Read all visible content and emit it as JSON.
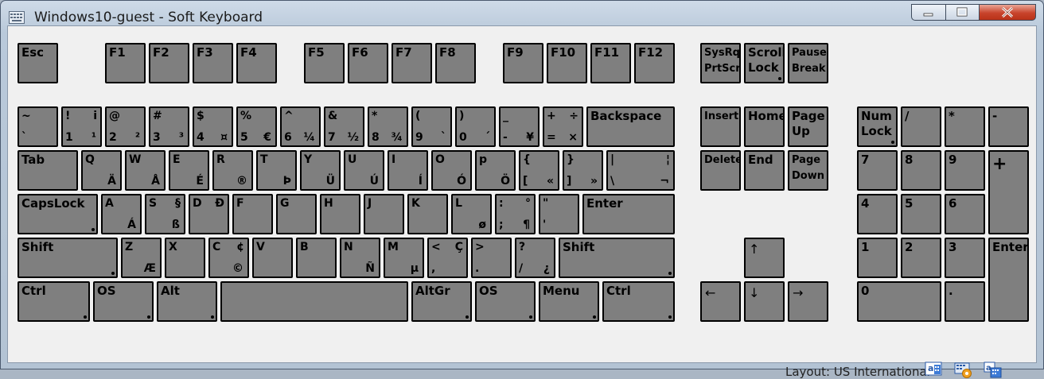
{
  "window": {
    "title": "Windows10-guest - Soft Keyboard"
  },
  "status": {
    "layout_label": "Layout: US International"
  },
  "status_icons": [
    {
      "name": "keyboard-language-icon"
    },
    {
      "name": "keyboard-settings-icon"
    },
    {
      "name": "keyboard-switch-icon"
    }
  ],
  "keys": [
    {
      "id": "esc",
      "label": "Esc"
    },
    {
      "id": "f1",
      "label": "F1"
    },
    {
      "id": "f2",
      "label": "F2"
    },
    {
      "id": "f3",
      "label": "F3"
    },
    {
      "id": "f4",
      "label": "F4"
    },
    {
      "id": "f5",
      "label": "F5"
    },
    {
      "id": "f6",
      "label": "F6"
    },
    {
      "id": "f7",
      "label": "F7"
    },
    {
      "id": "f8",
      "label": "F8"
    },
    {
      "id": "f9",
      "label": "F9"
    },
    {
      "id": "f10",
      "label": "F10"
    },
    {
      "id": "f11",
      "label": "F11"
    },
    {
      "id": "f12",
      "label": "F12"
    },
    {
      "id": "sysrq",
      "label2": "SysRq\nPrtScr"
    },
    {
      "id": "scrolllock",
      "label": "Scroll\nLock",
      "toggle": true
    },
    {
      "id": "pause",
      "label2": "Pause\nBreak"
    },
    {
      "id": "grave",
      "tl": "~",
      "bl": "`"
    },
    {
      "id": "1",
      "tl": "!",
      "tr": "i",
      "bl": "1",
      "br": "¹"
    },
    {
      "id": "2",
      "tl": "@",
      "bl": "2",
      "br": "²"
    },
    {
      "id": "3",
      "tl": "#",
      "bl": "3",
      "br": "³"
    },
    {
      "id": "4",
      "tl": "$",
      "bl": "4",
      "br": "¤"
    },
    {
      "id": "5",
      "tl": "%",
      "bl": "5",
      "br": "€"
    },
    {
      "id": "6",
      "tl": "^",
      "bl": "6",
      "br": "¼"
    },
    {
      "id": "7",
      "tl": "&",
      "bl": "7",
      "br": "½"
    },
    {
      "id": "8",
      "tl": "*",
      "bl": "8",
      "br": "¾"
    },
    {
      "id": "9",
      "tl": "(",
      "bl": "9",
      "br": "`"
    },
    {
      "id": "0",
      "tl": ")",
      "bl": "0",
      "br": "´"
    },
    {
      "id": "minus",
      "tl": "_",
      "bl": "-",
      "br": "¥"
    },
    {
      "id": "equals",
      "tl": "+",
      "tr": "÷",
      "bl": "=",
      "br": "×"
    },
    {
      "id": "backspace",
      "label": "Backspace"
    },
    {
      "id": "insert",
      "label2": "Insert"
    },
    {
      "id": "home",
      "label": "Home"
    },
    {
      "id": "pageup",
      "label": "Page\nUp"
    },
    {
      "id": "numlock",
      "label": "Num\nLock",
      "toggle": true
    },
    {
      "id": "numdiv",
      "label": "/"
    },
    {
      "id": "nummul",
      "label": "*"
    },
    {
      "id": "numsub",
      "label": "-"
    },
    {
      "id": "tab",
      "label": "Tab"
    },
    {
      "id": "q",
      "tl": "Q",
      "br": "Ä"
    },
    {
      "id": "w",
      "tl": "W",
      "br": "Å"
    },
    {
      "id": "e",
      "tl": "E",
      "br": "É"
    },
    {
      "id": "r",
      "tl": "R",
      "br": "®"
    },
    {
      "id": "t",
      "tl": "T",
      "br": "Þ"
    },
    {
      "id": "y",
      "tl": "Y",
      "br": "Ü"
    },
    {
      "id": "u",
      "tl": "U",
      "br": "Ú"
    },
    {
      "id": "i",
      "tl": "I",
      "br": "Í"
    },
    {
      "id": "o",
      "tl": "O",
      "br": "Ó"
    },
    {
      "id": "p",
      "tl": "p",
      "br": "Ö"
    },
    {
      "id": "lbracket",
      "tl": "{",
      "bl": "[",
      "br": "«"
    },
    {
      "id": "rbracket",
      "tl": "}",
      "bl": "]",
      "br": "»"
    },
    {
      "id": "backslash",
      "tl": "|",
      "tr": "¦",
      "bl": "\\",
      "br": "¬"
    },
    {
      "id": "delete",
      "label2": "Delete"
    },
    {
      "id": "end",
      "label": "End"
    },
    {
      "id": "pagedown",
      "label2": "Page\nDown"
    },
    {
      "id": "num7",
      "label": "7"
    },
    {
      "id": "num8",
      "label": "8"
    },
    {
      "id": "num9",
      "label": "9"
    },
    {
      "id": "numadd",
      "label": "+"
    },
    {
      "id": "capslock",
      "label": "CapsLock",
      "toggle": true
    },
    {
      "id": "a",
      "tl": "A",
      "br": "Á"
    },
    {
      "id": "s",
      "tl": "S",
      "tr": "§",
      "br": "ß"
    },
    {
      "id": "d",
      "tl": "D",
      "tr": "Ð"
    },
    {
      "id": "f",
      "tl": "F"
    },
    {
      "id": "g",
      "tl": "G"
    },
    {
      "id": "h",
      "tl": "H"
    },
    {
      "id": "j",
      "tl": "J"
    },
    {
      "id": "k",
      "tl": "K"
    },
    {
      "id": "l",
      "tl": "L",
      "br": "ø"
    },
    {
      "id": "semicolon",
      "tl": ":",
      "tr": "°",
      "bl": ";",
      "br": "¶"
    },
    {
      "id": "quote",
      "tl": "\"",
      "bl": "'"
    },
    {
      "id": "enter",
      "label": "Enter"
    },
    {
      "id": "num4",
      "label": "4"
    },
    {
      "id": "num5",
      "label": "5"
    },
    {
      "id": "num6",
      "label": "6"
    },
    {
      "id": "lshift",
      "label": "Shift",
      "toggle": true
    },
    {
      "id": "z",
      "tl": "Z",
      "br": "Æ"
    },
    {
      "id": "x",
      "tl": "X"
    },
    {
      "id": "c",
      "tl": "C",
      "tr": "¢",
      "br": "©"
    },
    {
      "id": "v",
      "tl": "V"
    },
    {
      "id": "b",
      "tl": "B"
    },
    {
      "id": "n",
      "tl": "N",
      "br": "Ñ"
    },
    {
      "id": "m",
      "tl": "M",
      "br": "µ"
    },
    {
      "id": "comma",
      "tl": "<",
      "tr": "Ç",
      "bl": ","
    },
    {
      "id": "period",
      "tl": ">",
      "bl": "."
    },
    {
      "id": "slash",
      "tl": "?",
      "bl": "/",
      "br": "¿"
    },
    {
      "id": "rshift",
      "label": "Shift",
      "toggle": true
    },
    {
      "id": "up",
      "arrow": "↑"
    },
    {
      "id": "num1",
      "label": "1"
    },
    {
      "id": "num2",
      "label": "2"
    },
    {
      "id": "num3",
      "label": "3"
    },
    {
      "id": "numenter",
      "label": "Enter"
    },
    {
      "id": "lctrl",
      "label": "Ctrl",
      "toggle": true
    },
    {
      "id": "los",
      "label": "OS",
      "toggle": true
    },
    {
      "id": "lalt",
      "label": "Alt",
      "toggle": true
    },
    {
      "id": "space",
      "label": ""
    },
    {
      "id": "altgr",
      "label": "AltGr",
      "toggle": true
    },
    {
      "id": "ros",
      "label": "OS",
      "toggle": true
    },
    {
      "id": "menu",
      "label": "Menu",
      "toggle": true
    },
    {
      "id": "rctrl",
      "label": "Ctrl",
      "toggle": true
    },
    {
      "id": "left",
      "arrow": "←"
    },
    {
      "id": "down",
      "arrow": "↓"
    },
    {
      "id": "right",
      "arrow": "→"
    },
    {
      "id": "num0",
      "label": "0"
    },
    {
      "id": "numdot",
      "label": "."
    }
  ]
}
